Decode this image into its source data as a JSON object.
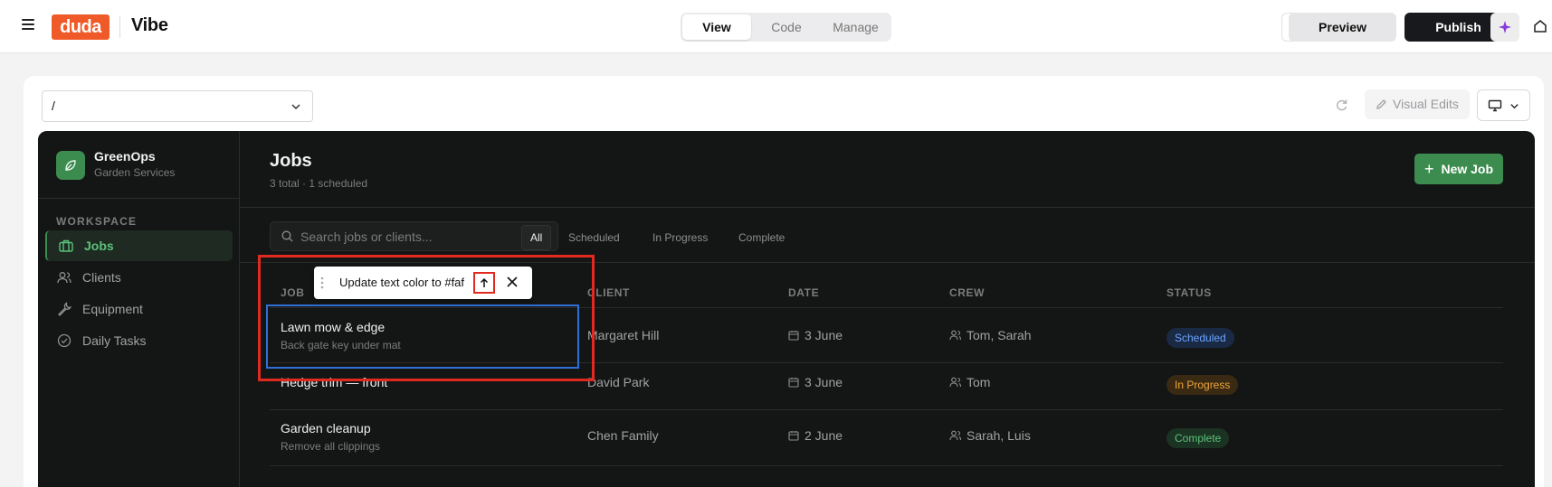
{
  "topbar": {
    "logo_text": "duda",
    "app_name": "Vibe",
    "modes": [
      "View",
      "Code",
      "Manage"
    ],
    "active_mode": "View",
    "preview_label": "Preview",
    "publish_label": "Publish",
    "colors": {
      "logo": "#f05a28",
      "publish_bg": "#17191c"
    }
  },
  "editor": {
    "path_value": "/",
    "visual_edits_label": "Visual Edits"
  },
  "app": {
    "brand": {
      "name": "GreenOps",
      "subtitle": "Garden Services"
    },
    "workspace_label": "WORKSPACE",
    "nav": [
      {
        "label": "Jobs",
        "icon": "briefcase-icon",
        "active": true
      },
      {
        "label": "Clients",
        "icon": "users-icon",
        "active": false
      },
      {
        "label": "Equipment",
        "icon": "wrench-icon",
        "active": false
      },
      {
        "label": "Daily Tasks",
        "icon": "check-circle-icon",
        "active": false
      }
    ],
    "page_title": "Jobs",
    "page_subtitle": "3 total · 1 scheduled",
    "new_job_label": "New Job",
    "search_placeholder": "Search jobs or clients...",
    "filters": [
      "All",
      "Scheduled",
      "In Progress",
      "Complete"
    ],
    "active_filter": "All",
    "columns": [
      "JOB",
      "CLIENT",
      "DATE",
      "CREW",
      "STATUS"
    ],
    "rows": [
      {
        "job": "Lawn mow & edge",
        "note": "Back gate key under mat",
        "client": "Margaret Hill",
        "date": "3 June",
        "crew": "Tom, Sarah",
        "status": "Scheduled"
      },
      {
        "job": "Hedge trim — front",
        "note": "",
        "client": "David Park",
        "date": "3 June",
        "crew": "Tom",
        "status": "In Progress"
      },
      {
        "job": "Garden cleanup",
        "note": "Remove all clippings",
        "client": "Chen Family",
        "date": "2 June",
        "crew": "Sarah, Luis",
        "status": "Complete"
      }
    ],
    "status_colors": {
      "Scheduled": {
        "bg": "#1b2a44",
        "fg": "#6aa3ff"
      },
      "In Progress": {
        "bg": "#3a2a14",
        "fg": "#f0a63a"
      },
      "Complete": {
        "bg": "#1a3322",
        "fg": "#5cc27a"
      }
    },
    "accent": "#3d8c4f"
  },
  "edit_popup": {
    "text": "Update text color to #faf"
  }
}
